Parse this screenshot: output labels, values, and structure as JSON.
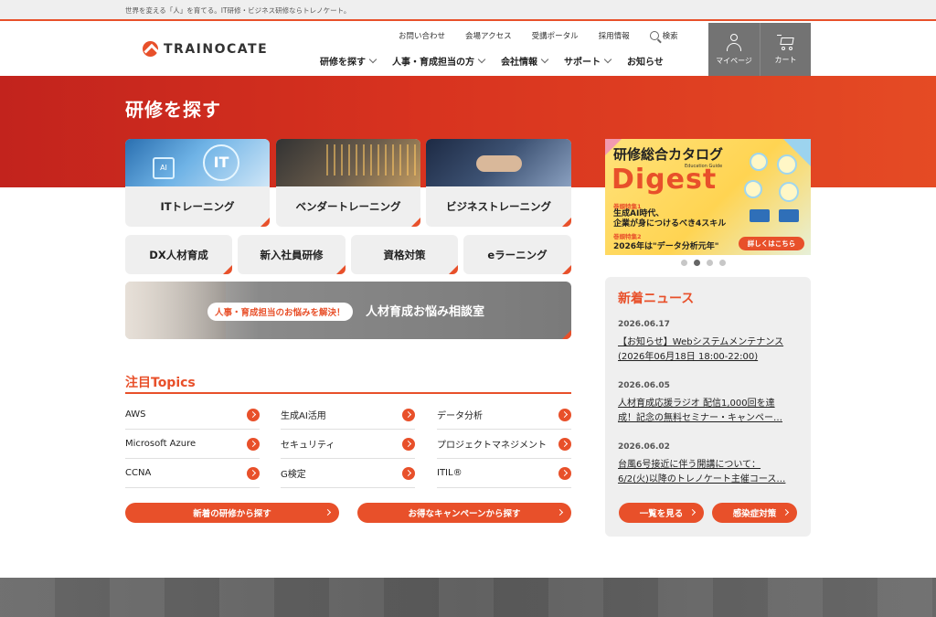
{
  "topbar": {
    "tagline": "世界を変える「人」を育てる。IT研修・ビジネス研修ならトレノケート。"
  },
  "brand": {
    "name": "TRAINOCATE",
    "accent": "#e8502a",
    "hero_red": "#d42a1e"
  },
  "utility_nav": [
    {
      "label": "お問い合わせ"
    },
    {
      "label": "会場アクセス"
    },
    {
      "label": "受講ポータル"
    },
    {
      "label": "採用情報"
    }
  ],
  "search": {
    "label": "検索",
    "icon": "search-icon"
  },
  "main_nav": [
    {
      "label": "研修を探す"
    },
    {
      "label": "人事・育成担当の方"
    },
    {
      "label": "会社情報"
    },
    {
      "label": "サポート"
    },
    {
      "label": "お知らせ"
    }
  ],
  "header_buttons": {
    "mypage": "マイページ",
    "cart": "カート"
  },
  "hero": {
    "title": "研修を探す"
  },
  "category_tiles": [
    {
      "label": "ITトレーニング",
      "image_icon": "it-training-image"
    },
    {
      "label": "ベンダートレーニング",
      "image_icon": "vendor-training-image"
    },
    {
      "label": "ビジネストレーニング",
      "image_icon": "business-training-image"
    }
  ],
  "sub_tiles": [
    {
      "label": "DX人材育成"
    },
    {
      "label": "新入社員研修"
    },
    {
      "label": "資格対策"
    },
    {
      "label": "eラーニング"
    }
  ],
  "consult_banner": {
    "pill": "人事・育成担当のお悩みを解決！",
    "title": "人材育成お悩み相談室"
  },
  "topics": {
    "title": "注目Topics",
    "columns": [
      [
        "AWS",
        "Microsoft Azure",
        "CCNA"
      ],
      [
        "生成AI活用",
        "セキュリティ",
        "G検定"
      ],
      [
        "データ分析",
        "プロジェクトマネジメント",
        "ITIL®"
      ]
    ]
  },
  "cta_buttons": {
    "new_courses": "新着の研修から探す",
    "campaigns": "お得なキャンペーンから探す"
  },
  "catalog_banner": {
    "title": "研修総合カタログ",
    "digest": "Digest",
    "sub": "Education Guide",
    "feature1_label": "巻頭特集1",
    "feature1_text_a": "生成AI時代、",
    "feature1_text_b": "企業が身につけるべき4スキル",
    "feature2_label": "巻頭特集2",
    "feature2_text": "2026年は\"データ分析元年\"",
    "button": "詳しくはこちら"
  },
  "carousel": {
    "count": 4,
    "active_index": 1
  },
  "news": {
    "title": "新着ニュース",
    "items": [
      {
        "date": "2026.06.17",
        "line1": "【お知らせ】Webシステムメンテナンス",
        "line2": "(2026年06月18日 18:00-22:00)"
      },
      {
        "date": "2026.06.05",
        "line1": "人材育成応援ラジオ 配信1,000回を達",
        "line2": "成！記念の無料セミナー・キャンペー…"
      },
      {
        "date": "2026.06.02",
        "line1": "台風6号接近に伴う開講について：",
        "line2": "6/2(火)以降のトレノケート主催コース…"
      }
    ],
    "see_all": "一覧を見る",
    "infection": "感染症対策"
  }
}
